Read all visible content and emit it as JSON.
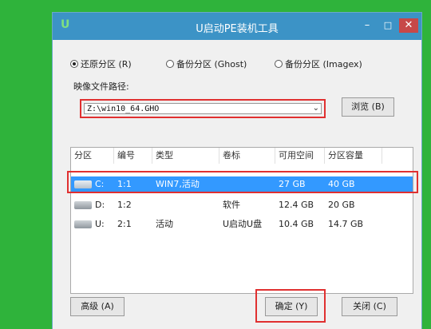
{
  "window": {
    "logo": "U",
    "title": "U启动PE装机工具",
    "min_label": "–",
    "max_label": "□",
    "close_label": "✕"
  },
  "modes": [
    {
      "label": "还原分区 (R)",
      "selected": true
    },
    {
      "label": "备份分区 (Ghost)",
      "selected": false
    },
    {
      "label": "备份分区 (Imagex)",
      "selected": false
    }
  ],
  "image_path": {
    "label": "映像文件路径:",
    "value": "Z:\\win10_64.GHO",
    "browse_label": "浏览 (B)"
  },
  "table": {
    "columns": [
      "分区",
      "编号",
      "类型",
      "卷标",
      "可用空间",
      "分区容量"
    ],
    "rows": [
      {
        "drive": "C:",
        "num": "1:1",
        "type": "WIN7,活动",
        "label": "",
        "free": "27 GB",
        "size": "40 GB",
        "selected": true
      },
      {
        "drive": "D:",
        "num": "1:2",
        "type": "",
        "label": "软件",
        "free": "12.4 GB",
        "size": "20 GB",
        "selected": false
      },
      {
        "drive": "U:",
        "num": "2:1",
        "type": "活动",
        "label": "U启动U盘",
        "free": "10.4 GB",
        "size": "14.7 GB",
        "selected": false
      }
    ]
  },
  "buttons": {
    "advanced": "高级 (A)",
    "ok": "确定 (Y)",
    "close": "关闭 (C)"
  },
  "colors": {
    "desktop": "#2fb33b",
    "titlebar": "#3c93c6",
    "selection": "#3399ff",
    "highlight": "#e03030"
  }
}
